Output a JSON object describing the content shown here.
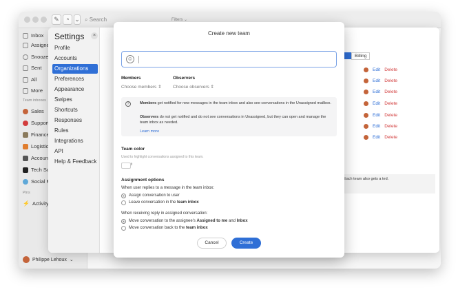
{
  "toolbar": {
    "search_placeholder": "Search",
    "filters_label": "Filters ⌄"
  },
  "sidebar": {
    "items": [
      {
        "label": "Inbox",
        "icon": "inbox-icon"
      },
      {
        "label": "Assigned",
        "icon": "assigned-icon"
      },
      {
        "label": "Snoozed",
        "icon": "clock-icon"
      },
      {
        "label": "Sent",
        "icon": "sent-icon"
      },
      {
        "label": "All",
        "icon": "all-icon"
      },
      {
        "label": "More",
        "icon": "more-icon"
      }
    ],
    "team_section": "Team inboxes",
    "teams": [
      {
        "label": "Sales",
        "color": "#c4643a"
      },
      {
        "label": "Support",
        "color": "#d23c3c"
      },
      {
        "label": "Finance",
        "color": "#8a7a5c"
      },
      {
        "label": "Logistics",
        "color": "#e07d2e"
      },
      {
        "label": "Accounts",
        "color": "#555555"
      },
      {
        "label": "Tech Sup",
        "color": "#222222"
      },
      {
        "label": "Social Me",
        "color": "#5fa8d8"
      }
    ],
    "pins_section": "Pins",
    "pins": [
      {
        "label": "Activity"
      }
    ],
    "user_name": "Philippe Lehoux"
  },
  "settings": {
    "title": "Settings",
    "close": "×",
    "nav": [
      "Profile",
      "Accounts",
      "Organizations",
      "Preferences",
      "Appearance",
      "Swipes",
      "Shortcuts",
      "Responses",
      "Rules",
      "Integrations",
      "API",
      "Help & Feedback"
    ],
    "active_index": 2,
    "billing_tab": "Billing",
    "rows": [
      {
        "edit": "Edit",
        "delete": "Delete"
      },
      {
        "edit": "Edit",
        "delete": "Delete"
      },
      {
        "edit": "Edit",
        "delete": "Delete"
      },
      {
        "edit": "Edit",
        "delete": "Delete"
      },
      {
        "edit": "Edit",
        "delete": "Delete"
      },
      {
        "edit": "Edit",
        "delete": "Delete"
      },
      {
        "edit": "Edit",
        "delete": "Delete"
      }
    ],
    "note": ". Each team also gets a ted."
  },
  "modal": {
    "title": "Create new team",
    "members_label": "Members",
    "members_select": "Choose members ⇕",
    "observers_label": "Observers",
    "observers_select": "Choose observers ⇕",
    "info_members_bold": "Members",
    "info_members_text": " get notified for new messages in the team inbox and also see conversations in the Unassigned mailbox.",
    "info_observers_bold": "Observers",
    "info_observers_text": " do not get notified and do not see conversations in Unassigned, but they can open and manage the team inbox as needed.",
    "learn_more": "Learn more",
    "team_color_label": "Team color",
    "team_color_sub": "Used to highlight conversations assigned to this team.",
    "assignment_title": "Assignment options",
    "q1": "When user replies to a message in the team inbox:",
    "q1_opt1": "Assign conversation to user",
    "q1_opt2_pre": "Leave conversation in the ",
    "q1_opt2_bold": "team inbox",
    "q2": "When receiving reply in assigned conversation:",
    "q2_opt1_pre": "Move conversation to the assignee's ",
    "q2_opt1_bold1": "Assigned to me",
    "q2_opt1_mid": " and ",
    "q2_opt1_bold2": "Inbox",
    "q2_opt2_pre": "Move conversation back to the ",
    "q2_opt2_bold": "team inbox",
    "cancel": "Cancel",
    "create": "Create"
  }
}
